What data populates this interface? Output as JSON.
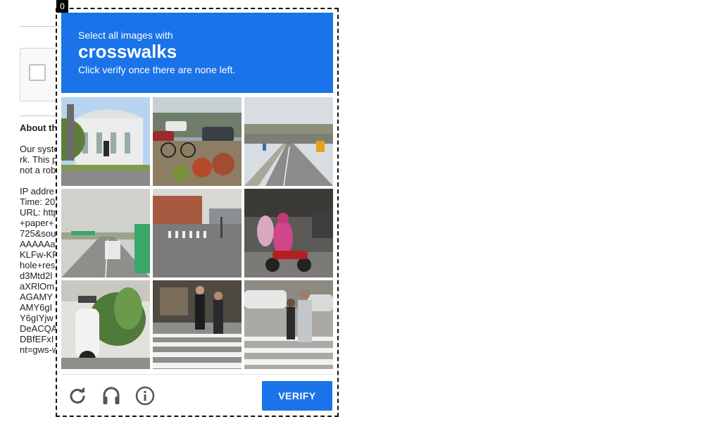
{
  "background_page": {
    "heading": "About th",
    "lines_a": [
      "Our syste",
      "rk. This p",
      "not a rob"
    ],
    "lines_b": [
      "IP addre",
      "Time: 20",
      "URL: http",
      "+paper+",
      "725&sou",
      "AAAAAa",
      "KLFw-KF",
      "hole+res",
      "d3Mtd2l",
      "aXRlOm",
      "AGAMY",
      "AMY6gI",
      "Y6gIYjw",
      "DeACQA",
      "DBfEFxI",
      "nt=gws-w"
    ]
  },
  "challenge": {
    "frame_index": "0",
    "instruction_prefix": "Select all images with",
    "keyword": "crosswalks",
    "instruction_suffix": "Click verify once there are none left.",
    "tiles": [
      {
        "name": "tile-station-building",
        "scene": "building"
      },
      {
        "name": "tile-parking-lot",
        "scene": "parking"
      },
      {
        "name": "tile-highway-overpass",
        "scene": "overpass"
      },
      {
        "name": "tile-highway-bus",
        "scene": "highway"
      },
      {
        "name": "tile-street-crosswalk",
        "scene": "street-crosswalk"
      },
      {
        "name": "tile-motorcycle-riders",
        "scene": "motorbike"
      },
      {
        "name": "tile-parked-scooter",
        "scene": "scooter"
      },
      {
        "name": "tile-pedestrians-crosswalk",
        "scene": "pedestrians"
      },
      {
        "name": "tile-man-crosswalk",
        "scene": "man-crossing"
      }
    ],
    "verify_label": "VERIFY",
    "icons": {
      "reload": "reload-icon",
      "audio": "headphones-icon",
      "info": "info-icon"
    }
  },
  "colors": {
    "accent": "#1a73e8",
    "icon_gray": "#555555"
  }
}
